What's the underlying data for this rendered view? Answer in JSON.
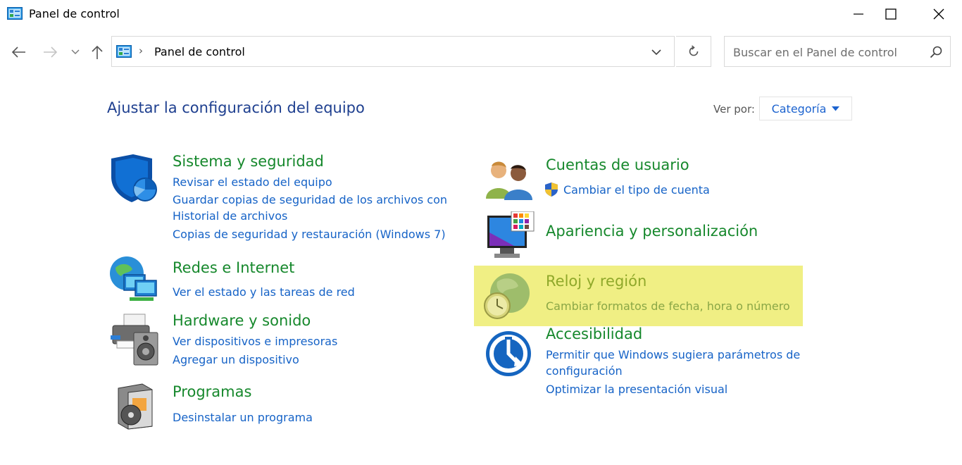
{
  "window": {
    "title": "Panel de control"
  },
  "address": {
    "path": "Panel de control",
    "separator": "›"
  },
  "search": {
    "placeholder": "Buscar en el Panel de control"
  },
  "header": {
    "title": "Ajustar la configuración del equipo",
    "view_by_label": "Ver por:",
    "view_by_value": "Categoría"
  },
  "categories": {
    "system": {
      "title": "Sistema y seguridad",
      "links": [
        "Revisar el estado del equipo",
        "Guardar copias de seguridad de los archivos con",
        "Historial de archivos",
        "Copias de seguridad y restauración (Windows 7)"
      ],
      "icon": "shield-icon"
    },
    "network": {
      "title": "Redes e Internet",
      "links": [
        "Ver el estado y las tareas de red"
      ],
      "icon": "network-globe-icon"
    },
    "hardware": {
      "title": "Hardware y sonido",
      "links": [
        "Ver dispositivos e impresoras",
        "Agregar un dispositivo"
      ],
      "icon": "printer-speaker-icon"
    },
    "programs": {
      "title": "Programas",
      "links": [
        "Desinstalar un programa"
      ],
      "icon": "programs-box-icon"
    },
    "users": {
      "title": "Cuentas de usuario",
      "links": [
        "Cambiar el tipo de cuenta"
      ],
      "icon": "users-icon"
    },
    "appearance": {
      "title": "Apariencia y personalización",
      "icon": "monitor-palette-icon"
    },
    "clock": {
      "title": "Reloj y región",
      "links": [
        "Cambiar formatos de fecha, hora o número"
      ],
      "icon": "clock-globe-icon"
    },
    "access": {
      "title": "Accesibilidad",
      "links": [
        "Permitir que Windows sugiera parámetros de",
        "configuración",
        "Optimizar la presentación visual"
      ],
      "icon": "accessibility-icon"
    }
  },
  "colors": {
    "category_title": "#16882c",
    "link": "#1663c7",
    "heading": "#1e3f8f",
    "highlight": "#f0ef84"
  }
}
